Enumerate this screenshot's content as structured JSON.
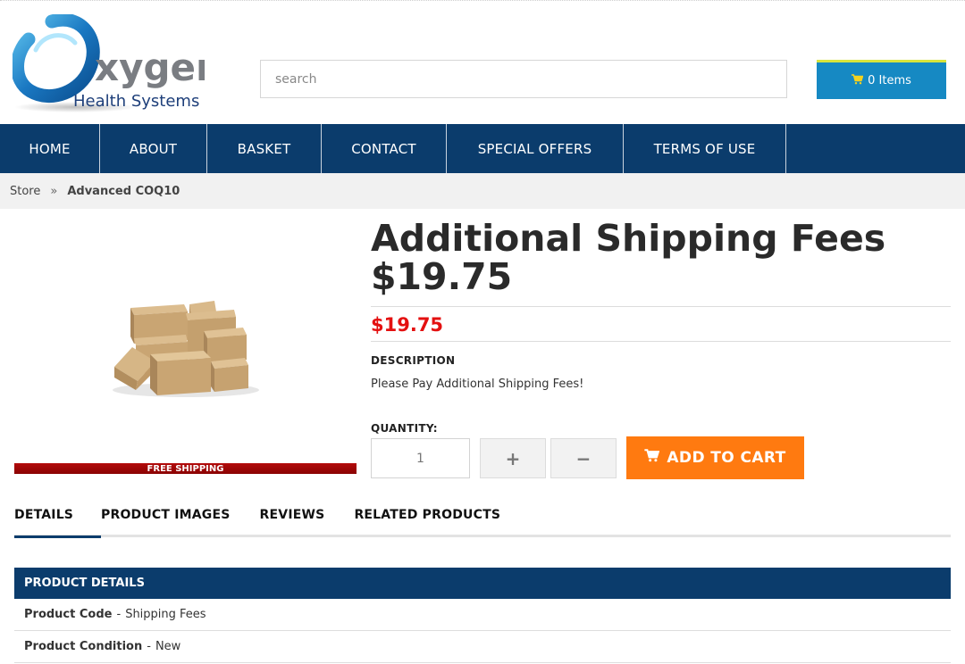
{
  "brand": {
    "logo_word": "xygen",
    "logo_sub": "Health Systems"
  },
  "search": {
    "placeholder": "search"
  },
  "cart": {
    "label": "0 Items",
    "icon": "shopping-cart-icon"
  },
  "nav": {
    "items": [
      {
        "label": "HOME"
      },
      {
        "label": "ABOUT"
      },
      {
        "label": "BASKET"
      },
      {
        "label": "CONTACT"
      },
      {
        "label": "SPECIAL OFFERS"
      },
      {
        "label": "TERMS OF USE"
      }
    ]
  },
  "breadcrumb": {
    "root": "Store",
    "separator": "»",
    "current": "Advanced COQ10"
  },
  "product": {
    "title": "Additional Shipping Fees $19.75",
    "price": "$19.75",
    "banner": "FREE SHIPPING",
    "description_label": "DESCRIPTION",
    "description": "Please Pay Additional Shipping Fees!",
    "quantity_label": "QUANTITY:",
    "quantity_value": "1",
    "plus_label": "+",
    "minus_label": "−",
    "add_to_cart_label": "ADD TO CART"
  },
  "tabs": [
    {
      "label": "DETAILS",
      "active": true
    },
    {
      "label": "PRODUCT IMAGES",
      "active": false
    },
    {
      "label": "REVIEWS",
      "active": false
    },
    {
      "label": "RELATED PRODUCTS",
      "active": false
    }
  ],
  "details": {
    "header": "PRODUCT DETAILS",
    "rows": [
      {
        "key": "Product Code",
        "value": "Shipping Fees"
      },
      {
        "key": "Product Condition",
        "value": "New"
      }
    ]
  },
  "colors": {
    "nav_bg": "#0b3c6c",
    "cart_bg": "#1689c3",
    "price": "#e41010",
    "add_to_cart": "#ff7a10",
    "banner": "#a00808"
  }
}
